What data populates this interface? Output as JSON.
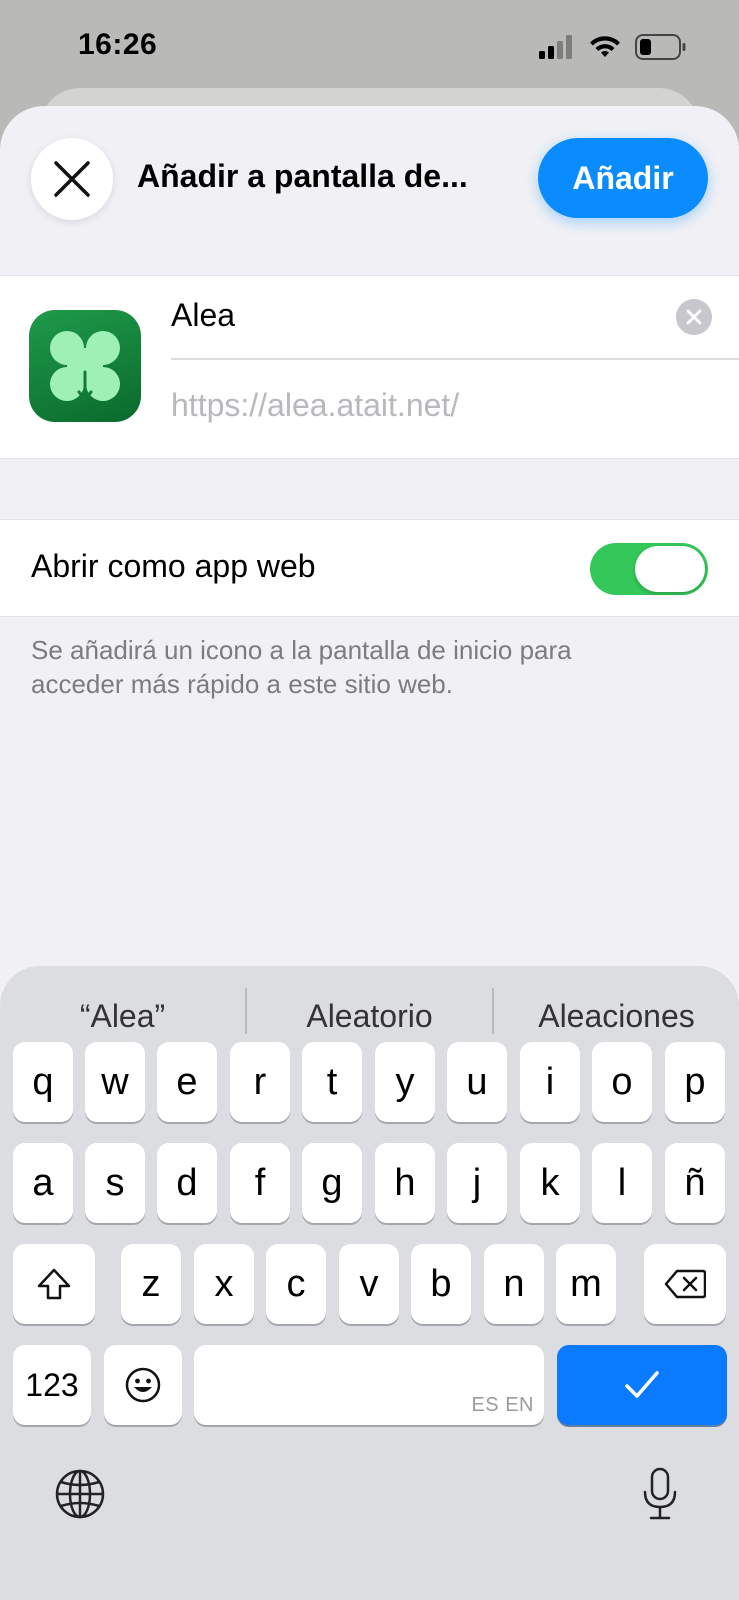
{
  "status_bar": {
    "time": "16:26",
    "signal_icon": "cellular-signal-icon",
    "wifi_icon": "wifi-icon",
    "battery_icon": "battery-low-icon"
  },
  "sheet": {
    "title": "Añadir a pantalla de...",
    "close_icon": "close-icon",
    "add_label": "Añadir",
    "add_color": "#0a8cff"
  },
  "app": {
    "icon": "alea-app-icon",
    "name": "Alea",
    "url": "https://alea.atait.net/"
  },
  "webapp_toggle": {
    "label": "Abrir como app web",
    "on": true,
    "color": "#34c759"
  },
  "footnote": "Se añadirá un icono a la pantalla de inicio para acceder más rápido a este sitio web.",
  "keyboard": {
    "suggestions": [
      "“Alea”",
      "Aleatorio",
      "Aleaciones"
    ],
    "row1": [
      "q",
      "w",
      "e",
      "r",
      "t",
      "y",
      "u",
      "i",
      "o",
      "p"
    ],
    "row2": [
      "a",
      "s",
      "d",
      "f",
      "g",
      "h",
      "j",
      "k",
      "l",
      "ñ"
    ],
    "row3": [
      "z",
      "x",
      "c",
      "v",
      "b",
      "n",
      "m"
    ],
    "numbers_label": "123",
    "space_languages": "ES EN",
    "done_color": "#0a7aff",
    "icons": [
      "shift-icon",
      "delete-icon",
      "emoji-icon",
      "checkmark-icon",
      "globe-icon",
      "microphone-icon"
    ]
  }
}
